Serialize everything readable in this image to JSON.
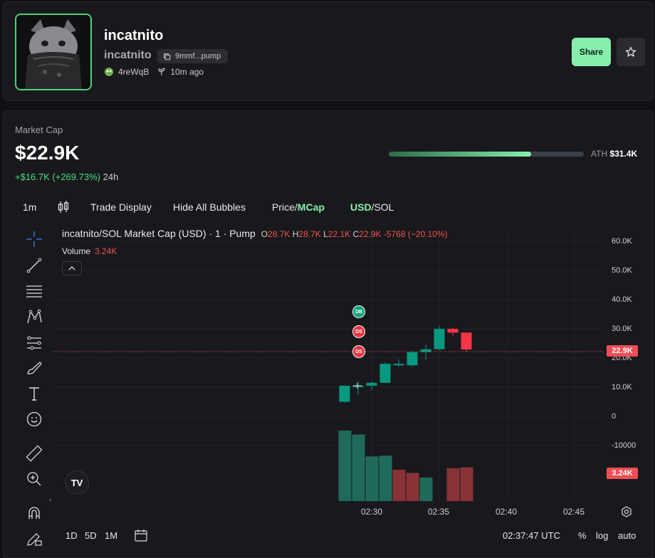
{
  "token": {
    "name": "incatnito",
    "ticker": "incatnito",
    "address_short": "9mmf...pump",
    "creator": "4reWqB",
    "age": "10m ago"
  },
  "actions": {
    "share_label": "Share"
  },
  "market": {
    "label": "Market Cap",
    "value": "$22.9K",
    "change": "+$16.7K (+269.73%)",
    "period": "24h",
    "ath_label": "ATH",
    "ath_value": "$31.4K",
    "ath_progress": 0.73
  },
  "toolbar": {
    "interval": "1m",
    "trade_display": "Trade Display",
    "hide_bubbles": "Hide All Bubbles",
    "price_label": "Price",
    "mcap_label": "MCap",
    "usd_label": "USD",
    "sol_label": "SOL"
  },
  "chart_header": {
    "symbol": "incatnito/SOL Market Cap (USD) · 1 · Pump",
    "o_key": "O",
    "o": "28.7K",
    "h_key": "H",
    "h": "28.7K",
    "l_key": "L",
    "l": "22.1K",
    "c_key": "C",
    "c": "22.9K",
    "chg": "-5768 (−20.10%)",
    "volume_label": "Volume",
    "volume_value": "3.24K"
  },
  "y_axis_labels": [
    "60.0K",
    "50.0K",
    "40.0K",
    "30.0K",
    "20.0K",
    "10.0K",
    "0",
    "-10000"
  ],
  "current_price_tag": "22.9K",
  "volume_tag": "3.24K",
  "x_axis_labels": [
    "02:30",
    "02:35",
    "02:40",
    "02:45"
  ],
  "badges": [
    "DB",
    "DS",
    "DS"
  ],
  "bottom": {
    "ranges": [
      "1D",
      "5D",
      "1M"
    ],
    "clock": "02:37:47 UTC",
    "percent": "%",
    "log": "log",
    "auto": "auto"
  },
  "colors": {
    "up": "#089981",
    "down": "#f23645",
    "accent": "#86efac"
  },
  "chart_data": {
    "type": "candlestick",
    "y_unit": "USD market cap",
    "ylim": [
      -20000,
      60000
    ],
    "candles": [
      {
        "o": 5000,
        "h": 10500,
        "l": 4500,
        "c": 10500
      },
      {
        "o": 10500,
        "h": 12000,
        "l": 7500,
        "c": 10500
      },
      {
        "o": 10500,
        "h": 12000,
        "l": 9000,
        "c": 11500
      },
      {
        "o": 11500,
        "h": 18500,
        "l": 11500,
        "c": 18000
      },
      {
        "o": 17500,
        "h": 19500,
        "l": 17000,
        "c": 18000
      },
      {
        "o": 17500,
        "h": 22500,
        "l": 17000,
        "c": 22000
      },
      {
        "o": 22000,
        "h": 24500,
        "l": 19500,
        "c": 23000
      },
      {
        "o": 23000,
        "h": 31000,
        "l": 22500,
        "c": 30000
      },
      {
        "o": 30000,
        "h": 30500,
        "l": 27500,
        "c": 28700
      },
      {
        "o": 28700,
        "h": 28700,
        "l": 22100,
        "c": 22900
      }
    ],
    "volumes": [
      9,
      8.5,
      5.7,
      5.8,
      4,
      3.6,
      3.0,
      0,
      4.2,
      4.3
    ],
    "volume_colors": [
      "up",
      "up",
      "up",
      "up",
      "down",
      "down",
      "up",
      "none",
      "down",
      "down"
    ],
    "time_labels": [
      "02:30",
      "02:35",
      "02:40",
      "02:45"
    ]
  }
}
